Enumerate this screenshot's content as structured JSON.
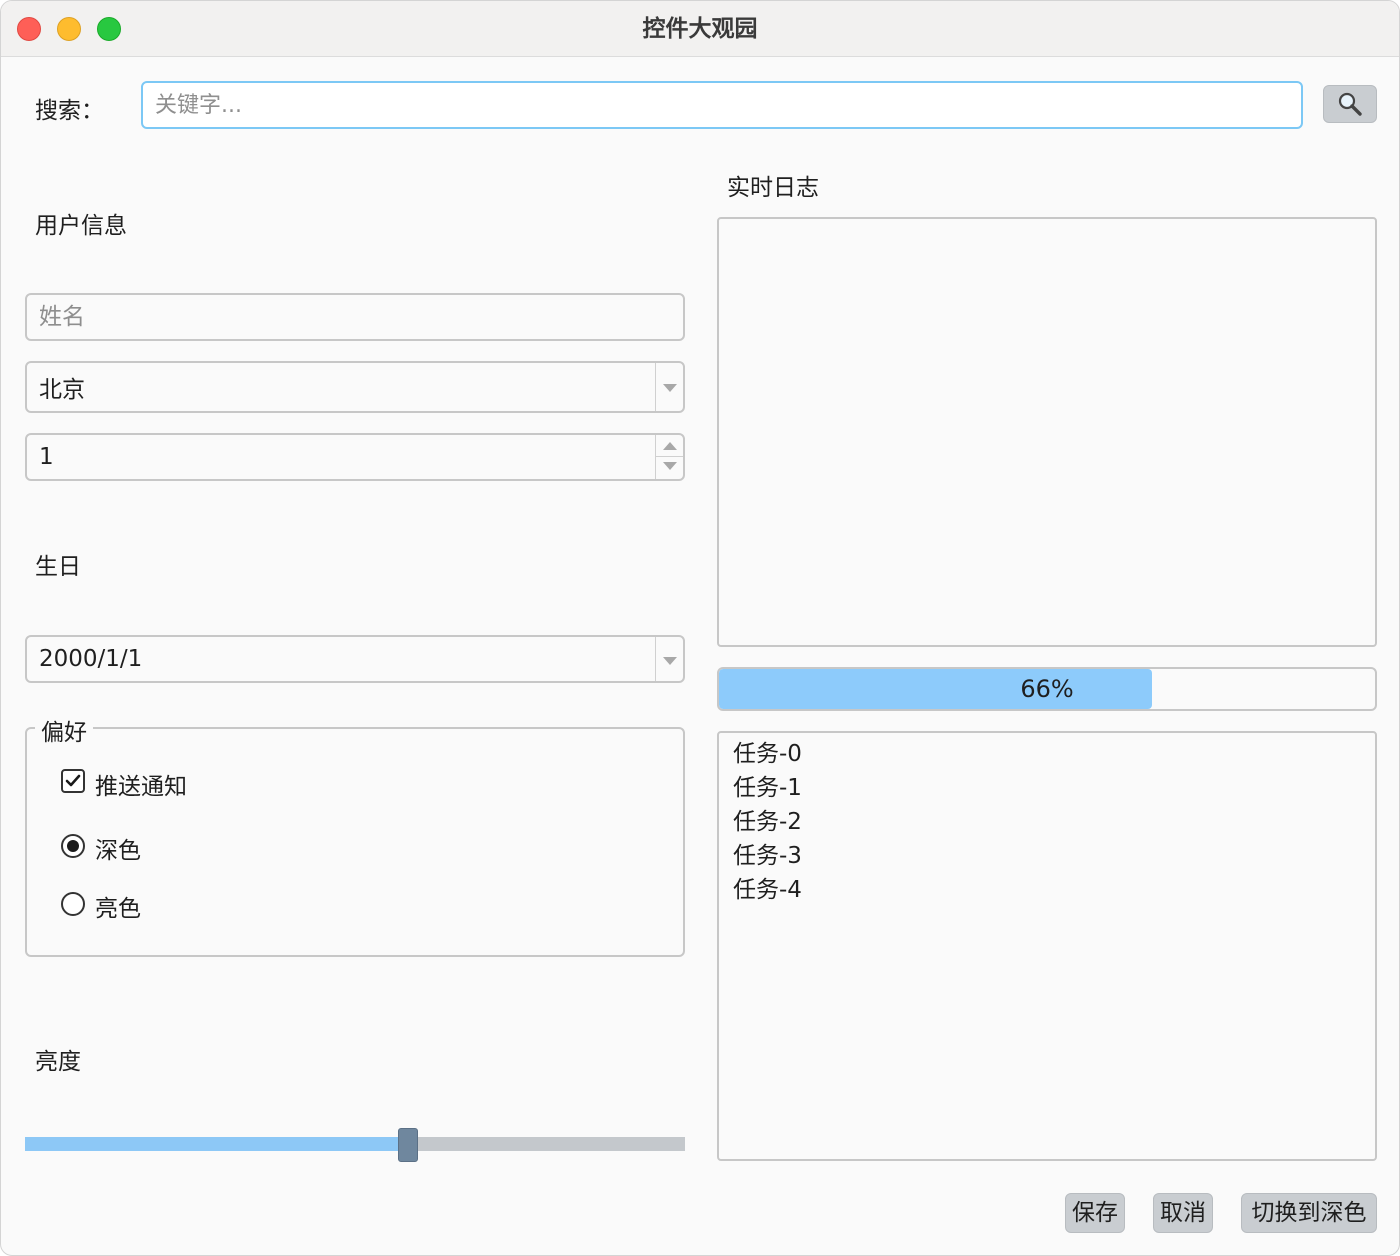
{
  "window": {
    "title": "控件大观园"
  },
  "search": {
    "label": "搜索：",
    "placeholder": "关键字...",
    "icon": "magnifier-icon"
  },
  "user_info": {
    "heading": "用户信息",
    "name_placeholder": "姓名",
    "city": "北京",
    "spin_value": "1"
  },
  "birthday": {
    "heading": "生日",
    "date": "2000/1/1"
  },
  "preferences": {
    "title": "偏好",
    "push_label": "推送通知",
    "push_checked": true,
    "dark_label": "深色",
    "light_label": "亮色",
    "selected_theme": "深色"
  },
  "brightness": {
    "heading": "亮度",
    "value": 0.58
  },
  "log": {
    "heading": "实时日志"
  },
  "progress": {
    "value": 66,
    "text": "66%"
  },
  "tasks": [
    "任务-0",
    "任务-1",
    "任务-2",
    "任务-3",
    "任务-4"
  ],
  "buttons": {
    "save": "保存",
    "cancel": "取消",
    "toggle_theme": "切换到深色"
  },
  "colors": {
    "accent": "#8dcbfb",
    "focus_border": "#7cc8f5",
    "button_bg": "#c9cdd1",
    "slider_handle": "#6f879e"
  }
}
